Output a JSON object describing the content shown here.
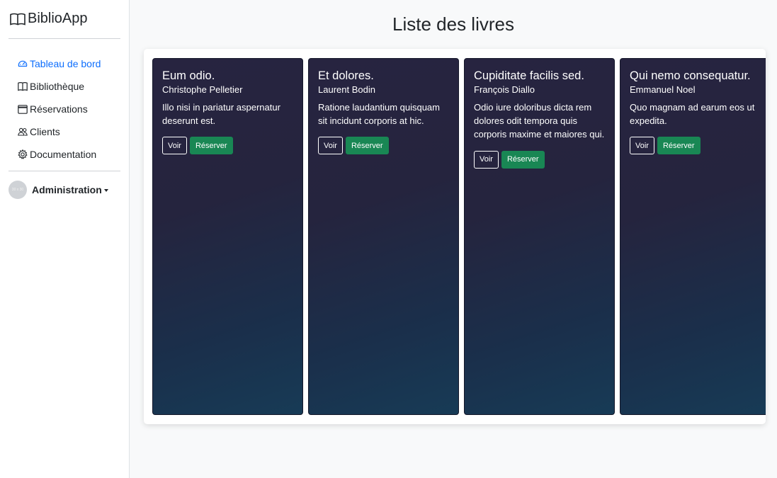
{
  "sidebar": {
    "brand": "BiblioApp",
    "nav": [
      {
        "label": "Tableau de bord",
        "icon": "speedometer-icon",
        "active": true
      },
      {
        "label": "Bibliothèque",
        "icon": "book-icon"
      },
      {
        "label": "Réservations",
        "icon": "calendar-icon"
      },
      {
        "label": "Clients",
        "icon": "people-icon"
      },
      {
        "label": "Documentation",
        "icon": "gear-icon"
      }
    ],
    "admin": {
      "label": "Administration",
      "avatar_text": "30 x 30"
    }
  },
  "main": {
    "title": "Liste des livres",
    "cards": [
      {
        "title": "Eum odio.",
        "author": "Christophe Pelletier",
        "description": "Illo nisi in pariatur aspernatur deserunt est.",
        "view_label": "Voir",
        "reserve_label": "Réserver"
      },
      {
        "title": "Et dolores.",
        "author": "Laurent Bodin",
        "description": "Ratione laudantium quisquam sit incidunt corporis at hic.",
        "view_label": "Voir",
        "reserve_label": "Réserver"
      },
      {
        "title": "Cupiditate facilis sed.",
        "author": "François Diallo",
        "description": "Odio iure doloribus dicta rem dolores odit tempora quis corporis maxime et maiores qui.",
        "view_label": "Voir",
        "reserve_label": "Réserver"
      },
      {
        "title": "Qui nemo consequatur.",
        "author": "Emmanuel Noel",
        "description": "Quo magnam ad earum eos ut expedita.",
        "view_label": "Voir",
        "reserve_label": "Réserver"
      }
    ]
  },
  "colors": {
    "accent": "#0d6efd",
    "success": "#198754",
    "card_top": "#272440",
    "card_bottom": "#173b56"
  }
}
